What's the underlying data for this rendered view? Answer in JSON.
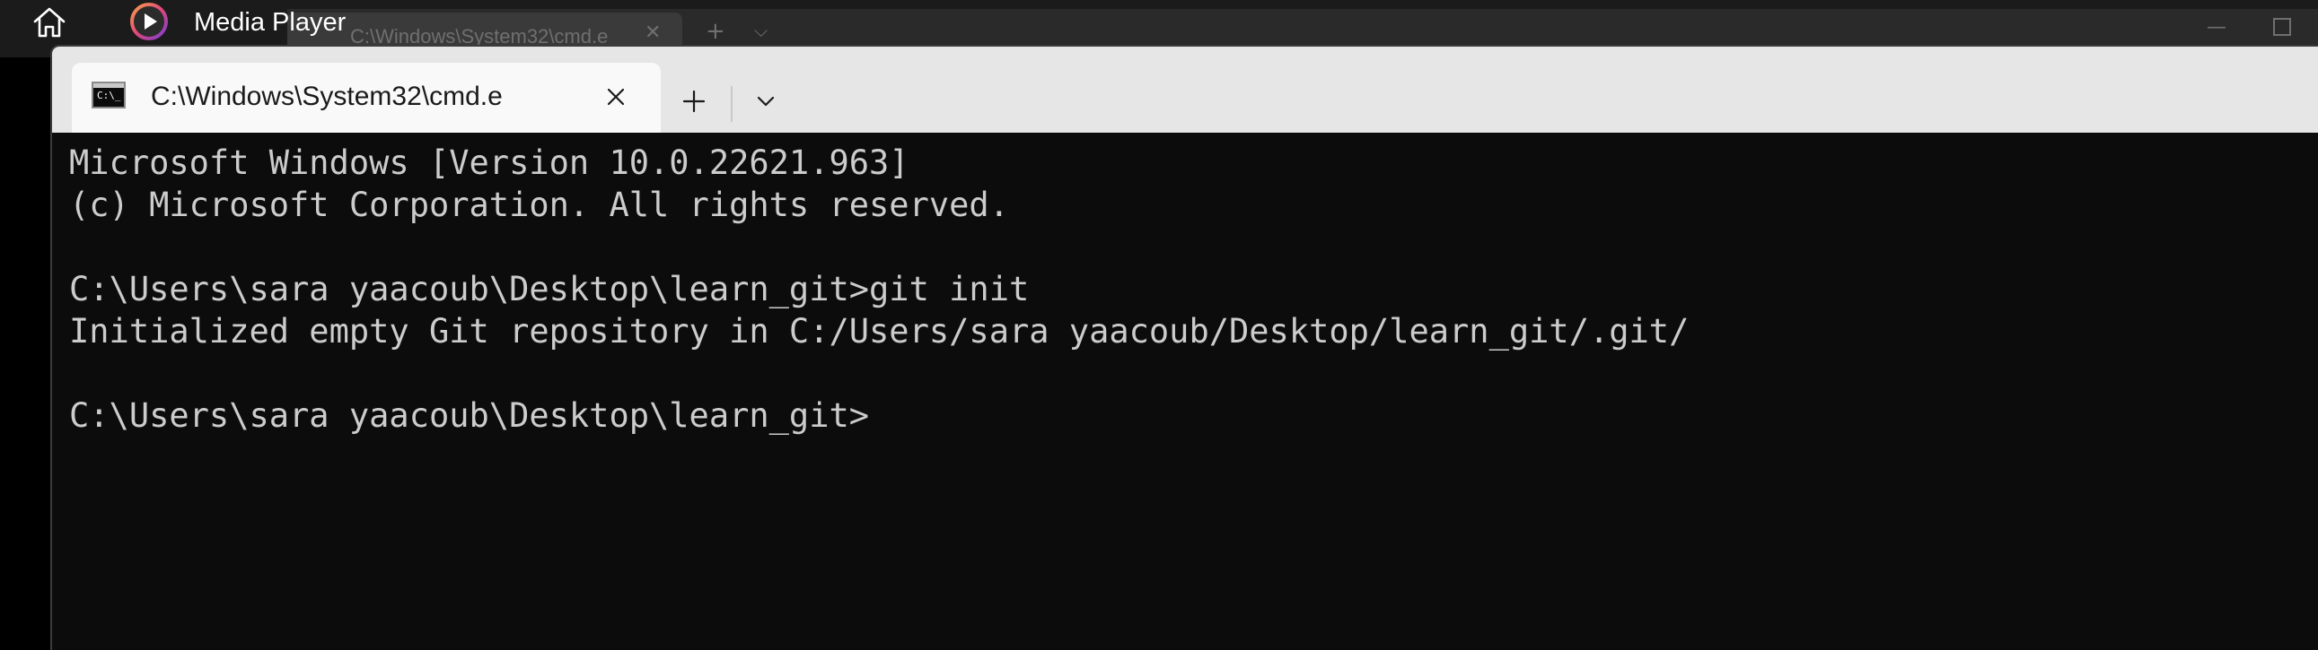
{
  "taskbar": {
    "home_icon": "home-icon",
    "app_icon": "media-player-icon",
    "app_title": "Media Player"
  },
  "background_window": {
    "tab_label": "C:\\Windows\\System32\\cmd.e",
    "close_glyph": "✕",
    "plus_glyph": "+",
    "chevron_glyph": "⌵",
    "minimize_glyph": "—"
  },
  "window": {
    "tab": {
      "icon": "cmd-icon",
      "icon_prompt": "C:\\_",
      "label": "C:\\Windows\\System32\\cmd.e",
      "close_icon": "close-icon"
    },
    "new_tab_icon": "plus-icon",
    "dropdown_icon": "chevron-down-icon"
  },
  "terminal": {
    "lines": [
      "Microsoft Windows [Version 10.0.22621.963]",
      "(c) Microsoft Corporation. All rights reserved.",
      "",
      "C:\\Users\\sara yaacoub\\Desktop\\learn_git>git init",
      "Initialized empty Git repository in C:/Users/sara yaacoub/Desktop/learn_git/.git/",
      "",
      "C:\\Users\\sara yaacoub\\Desktop\\learn_git>"
    ]
  },
  "colors": {
    "terminal_bg": "#0c0c0c",
    "terminal_text": "#cccccc",
    "tabbar_bg": "#e6e6e6",
    "active_tab_bg": "#f9f9f9",
    "media_player_accent": "#e0457b"
  }
}
